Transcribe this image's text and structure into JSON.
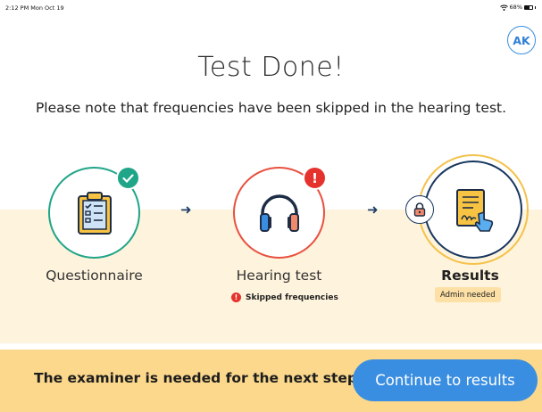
{
  "status_bar": {
    "time": "2:12 PM  Mon Oct 19",
    "battery": "68%"
  },
  "user": {
    "initials": "AK"
  },
  "title": "Test Done!",
  "subtitle": "Please note that frequencies have been skipped in the hearing test.",
  "steps": [
    {
      "label": "Questionnaire",
      "status": "complete",
      "icon": "clipboard-checklist-icon"
    },
    {
      "label": "Hearing test",
      "status": "warning",
      "icon": "headphones-icon",
      "note": "Skipped frequencies"
    },
    {
      "label": "Results",
      "status": "locked",
      "icon": "signed-document-icon",
      "tag": "Admin needed"
    }
  ],
  "footer": {
    "message": "The examiner is needed for the next step",
    "button_label": "Continue to results"
  },
  "colors": {
    "complete": "#1fa588",
    "warning": "#e5322d",
    "locked": "#17365f",
    "accent": "#3a8ee1",
    "band": "#fef3dc",
    "footer": "#fbd88c"
  }
}
